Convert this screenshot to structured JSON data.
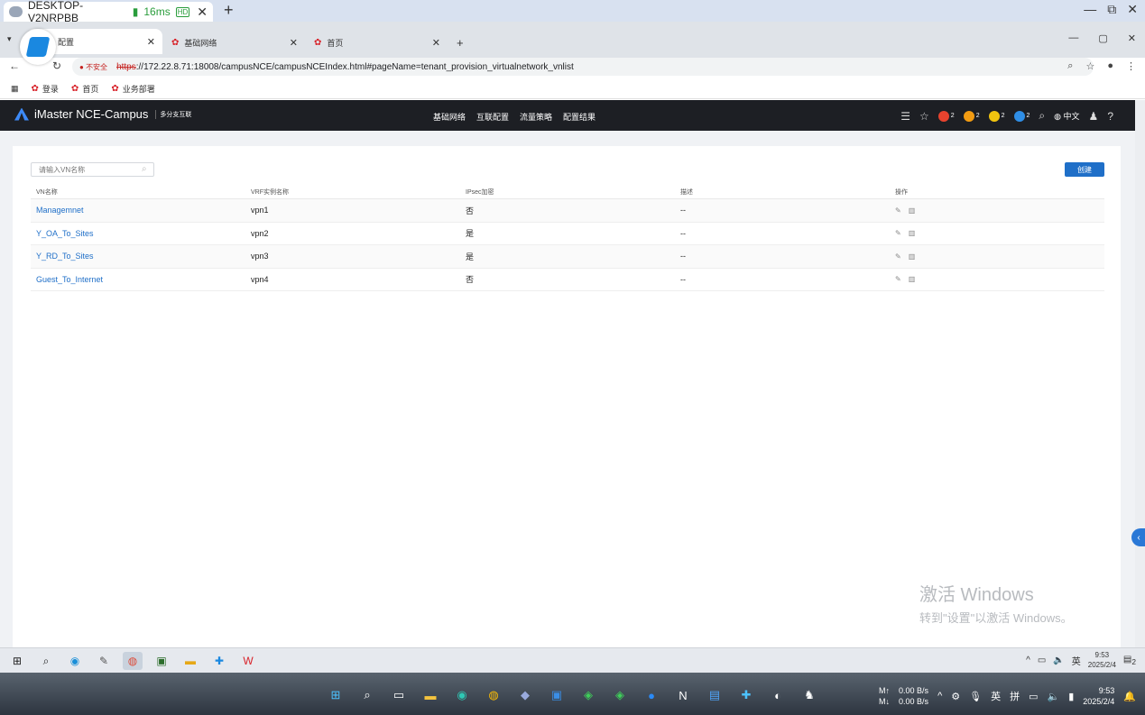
{
  "remote_bar": {
    "title": "DESKTOP-V2NRPBB",
    "latency": "16ms",
    "hd": "HD",
    "close": "✕",
    "plus": "+",
    "controls": [
      "—",
      "⧉",
      "✕"
    ]
  },
  "browser": {
    "tabs": [
      {
        "label": "配置",
        "close": "✕"
      },
      {
        "label": "基础网络",
        "close": "✕"
      },
      {
        "label": "首页",
        "close": "✕"
      }
    ],
    "new_tab": "+",
    "window_controls": [
      "—",
      "▢",
      "✕"
    ],
    "insecure_label": "不安全",
    "url_scheme": "https",
    "url_rest": "://172.22.8.71:18008/campusNCE/campusNCEIndex.html#pageName=tenant_provision_virtualnetwork_vnlist",
    "bookmarks": [
      "登录",
      "首页",
      "业务部署"
    ]
  },
  "app": {
    "product": "iMaster NCE-Campus",
    "sub": "多分支互联",
    "nav": [
      "基础网络",
      "互联配置",
      "流量策略",
      "配置结果"
    ],
    "alarms": [
      {
        "count": "2",
        "color": "#e8432e"
      },
      {
        "count": "2",
        "color": "#f39c12"
      },
      {
        "count": "2",
        "color": "#f1c40f"
      },
      {
        "count": "2",
        "color": "#2f8ee6"
      }
    ],
    "language": "中文"
  },
  "vn_list": {
    "search_placeholder": "请输入VN名称",
    "create_label": "创建",
    "columns": [
      "VN名称",
      "VRF实例名称",
      "IPsec加密",
      "描述",
      "操作"
    ],
    "rows": [
      {
        "name": "Managemnet",
        "vrf": "vpn1",
        "ipsec": "否",
        "desc": "--"
      },
      {
        "name": "Y_OA_To_Sites",
        "vrf": "vpn2",
        "ipsec": "是",
        "desc": "--"
      },
      {
        "name": "Y_RD_To_Sites",
        "vrf": "vpn3",
        "ipsec": "是",
        "desc": "--"
      },
      {
        "name": "Guest_To_Internet",
        "vrf": "vpn4",
        "ipsec": "否",
        "desc": "--"
      }
    ]
  },
  "watermark": {
    "line1": "激活 Windows",
    "line2": "转到\"设置\"以激活 Windows。"
  },
  "remote_taskbar": {
    "ime": "英",
    "time": "9:53",
    "date": "2025/2/4",
    "notify": "2"
  },
  "local_taskbar": {
    "net_label_up": "M↑",
    "net_label_down": "M↓",
    "net_up": "0.00 B/s",
    "net_down": "0.00 B/s",
    "ime_en": "英",
    "ime_pin": "拼",
    "time": "9:53",
    "date": "2025/2/4"
  }
}
